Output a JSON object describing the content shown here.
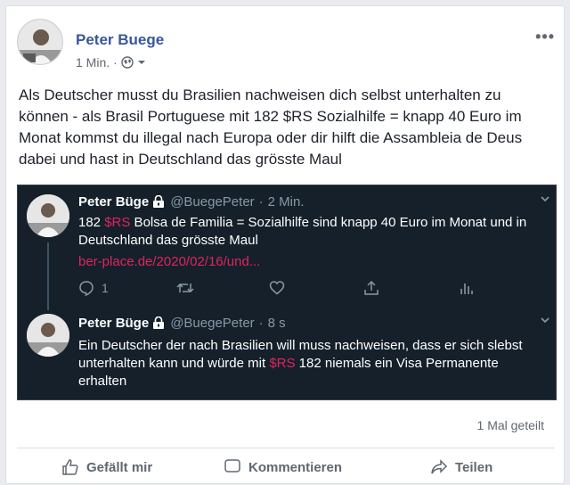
{
  "post": {
    "author": "Peter Buege",
    "time": "1 Min.",
    "separator": "·",
    "more_label": "•••",
    "text": "Als Deutscher musst du Brasilien nachweisen dich selbst unterhalten zu können - als Brasil Portuguese mit 182 $RS Sozialhilfe = knapp 40 Euro im Monat kommst du illegal nach Europa oder dir hilft die Assambleia de Deus dabei und hast in Deutschland das grösste Maul"
  },
  "tweets": [
    {
      "name": "Peter Büge",
      "handle": "@BuegePeter",
      "sep": "·",
      "time": "2 Min.",
      "text_pre": "182 ",
      "text_red": "$RS",
      "text_post": " Bolsa de Familia = Sozialhilfe  sind knapp 40 Euro im Monat und in Deutschland das grösste Maul",
      "link": "ber-place.de/2020/02/16/und...",
      "reply_count": "1"
    },
    {
      "name": "Peter Büge",
      "handle": "@BuegePeter",
      "sep": "·",
      "time": "8 s",
      "text_pre": "Ein Deutscher der nach Brasilien will muss nachweisen, dass er sich slebst unterhalten kann und würde mit ",
      "text_red": "$RS",
      "text_post": " 182 niemals ein Visa Permanente erhalten"
    }
  ],
  "footer": {
    "shares": "1 Mal geteilt",
    "like_label": "Gefällt mir",
    "comment_label": "Kommentieren",
    "share_label": "Teilen"
  },
  "colors": {
    "author_blue": "#385898",
    "tweet_bg": "#15202b",
    "accent_red": "#e0245e"
  }
}
